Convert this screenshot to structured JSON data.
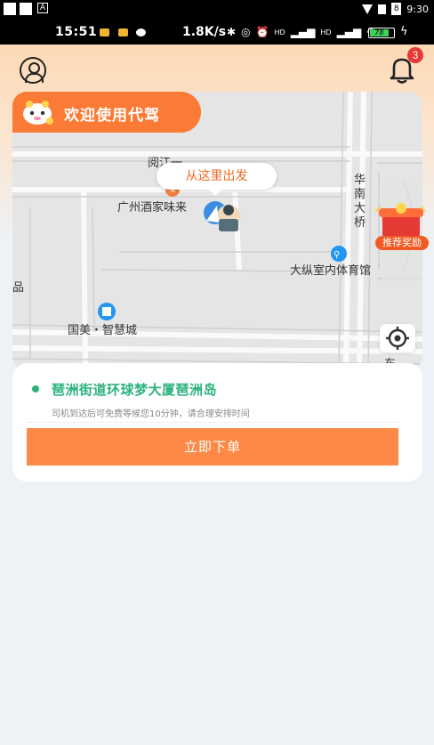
{
  "status_bar_top": {
    "left_label": "A",
    "battery_label": "8",
    "time": "9:30"
  },
  "status_bar": {
    "time": "15:51",
    "speed": "1.8K/s",
    "hd1": "HD",
    "hd2": "HD",
    "battery": "78"
  },
  "header": {
    "profile_icon": "user-icon",
    "bell_icon": "bell-icon",
    "notification_count": "3"
  },
  "welcome": {
    "text": "欢迎使用代驾",
    "logo": "mascot-logo"
  },
  "map": {
    "start_bubble": "从这里出发",
    "labels": {
      "road_top": "阅江一",
      "restaurant": "广州酒家味来",
      "bridge_1": "华",
      "bridge_2": "南",
      "bridge_3": "大",
      "bridge_4": "桥",
      "stadium": "大纵室内体育馆",
      "mall": "国美・智慧城",
      "left_edge": "品",
      "right_edge": "东"
    },
    "reward_label": "推荐奖励",
    "locate_icon": "locate-icon",
    "colors": {
      "accent": "#fb7a35",
      "green": "#2bb27c",
      "poi_blue": "#2196f3"
    }
  },
  "address": {
    "text": "琶洲街道环球梦大厦琶洲岛",
    "note": "司机到达后可免费等候您10分钟，请合理安排时间",
    "button": "立即下单"
  }
}
